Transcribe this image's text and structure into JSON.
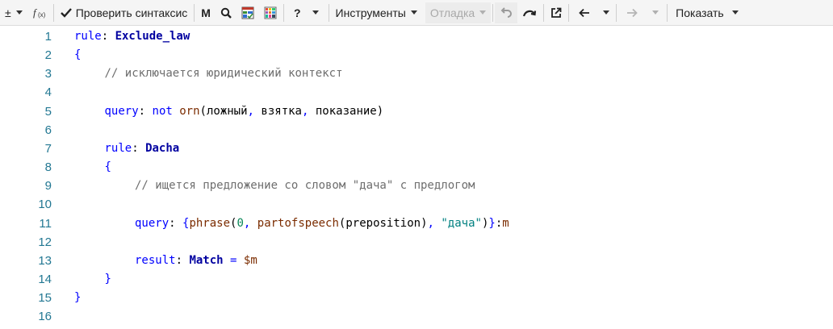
{
  "toolbar": {
    "plusminus_label": "±",
    "fx_label": "f(x)",
    "check_syntax_label": "Проверить синтаксис",
    "m_label": "M",
    "help_label": "?",
    "tools_label": "Инструменты",
    "debug_label": "Отладка",
    "show_label": "Показать"
  },
  "editor": {
    "lines": [
      {
        "n": "1",
        "indent": 0,
        "tokens": [
          {
            "t": "rule",
            "c": "t-kw"
          },
          {
            "t": ": ",
            "c": "t-plain"
          },
          {
            "t": "Exclude_law",
            "c": "t-name"
          }
        ]
      },
      {
        "n": "2",
        "indent": 0,
        "tokens": [
          {
            "t": "{",
            "c": "t-brace"
          }
        ]
      },
      {
        "n": "3",
        "indent": 1,
        "tokens": [
          {
            "t": "// исключается юридический контекст",
            "c": "t-comment"
          }
        ]
      },
      {
        "n": "4",
        "indent": 0,
        "tokens": []
      },
      {
        "n": "5",
        "indent": 1,
        "tokens": [
          {
            "t": "query",
            "c": "t-kw"
          },
          {
            "t": ": ",
            "c": "t-plain"
          },
          {
            "t": "not ",
            "c": "t-kw"
          },
          {
            "t": "orn",
            "c": "t-fn2"
          },
          {
            "t": "(ложный",
            "c": "t-plain"
          },
          {
            "t": ",",
            "c": "t-op"
          },
          {
            "t": " взятка",
            "c": "t-plain"
          },
          {
            "t": ",",
            "c": "t-op"
          },
          {
            "t": " показание)",
            "c": "t-plain"
          }
        ]
      },
      {
        "n": "6",
        "indent": 0,
        "tokens": []
      },
      {
        "n": "7",
        "indent": 1,
        "tokens": [
          {
            "t": "rule",
            "c": "t-kw"
          },
          {
            "t": ": ",
            "c": "t-plain"
          },
          {
            "t": "Dacha",
            "c": "t-name"
          }
        ]
      },
      {
        "n": "8",
        "indent": 1,
        "tokens": [
          {
            "t": "{",
            "c": "t-brace"
          }
        ]
      },
      {
        "n": "9",
        "indent": 2,
        "tokens": [
          {
            "t": "// ищется предложение со словом \"дача\" с предлогом",
            "c": "t-comment"
          }
        ]
      },
      {
        "n": "10",
        "indent": 0,
        "tokens": []
      },
      {
        "n": "11",
        "indent": 2,
        "tokens": [
          {
            "t": "query",
            "c": "t-kw"
          },
          {
            "t": ": ",
            "c": "t-plain"
          },
          {
            "t": "{",
            "c": "t-brace"
          },
          {
            "t": "phrase",
            "c": "t-fn2"
          },
          {
            "t": "(",
            "c": "t-plain"
          },
          {
            "t": "0",
            "c": "t-num"
          },
          {
            "t": ", ",
            "c": "t-op"
          },
          {
            "t": "partofspeech",
            "c": "t-fn2"
          },
          {
            "t": "(preposition)",
            "c": "t-plain"
          },
          {
            "t": ", ",
            "c": "t-op"
          },
          {
            "t": "\"дача\"",
            "c": "t-str"
          },
          {
            "t": ")",
            "c": "t-plain"
          },
          {
            "t": "}",
            "c": "t-brace"
          },
          {
            "t": ":",
            "c": "t-plain"
          },
          {
            "t": "m",
            "c": "t-fn2"
          }
        ]
      },
      {
        "n": "12",
        "indent": 0,
        "tokens": []
      },
      {
        "n": "13",
        "indent": 2,
        "tokens": [
          {
            "t": "result",
            "c": "t-kw"
          },
          {
            "t": ": ",
            "c": "t-plain"
          },
          {
            "t": "Match",
            "c": "t-kwb"
          },
          {
            "t": " = ",
            "c": "t-op"
          },
          {
            "t": "$m",
            "c": "t-fn2"
          }
        ]
      },
      {
        "n": "14",
        "indent": 1,
        "tokens": [
          {
            "t": "}",
            "c": "t-brace"
          }
        ]
      },
      {
        "n": "15",
        "indent": 0,
        "tokens": [
          {
            "t": "}",
            "c": "t-brace"
          }
        ]
      },
      {
        "n": "16",
        "indent": 0,
        "tokens": []
      }
    ]
  },
  "icons": {
    "check": "checkmark-icon",
    "search": "magnifier-icon",
    "table": "table-icon",
    "grid": "color-grid-icon",
    "undo": "undo-icon",
    "redo": "redo-icon",
    "external": "open-external-icon",
    "back": "arrow-left-icon",
    "forward": "arrow-right-icon"
  }
}
